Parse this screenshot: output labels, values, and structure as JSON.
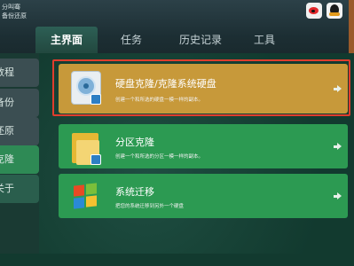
{
  "header": {
    "app_title_line1": "分叫骞",
    "app_title_line2": "备份还原"
  },
  "tabs": [
    {
      "label": "主界面"
    },
    {
      "label": "任务"
    },
    {
      "label": "历史记录"
    },
    {
      "label": "工具"
    }
  ],
  "sidebar": {
    "items": [
      {
        "label": "数程"
      },
      {
        "label": "备份"
      },
      {
        "label": "还原"
      },
      {
        "label": "克隆"
      },
      {
        "label": "关于"
      }
    ]
  },
  "cards": [
    {
      "title": "硬盘克隆/克隆系统硬盘",
      "desc": "创建一个和所选的硬盘一模一样的副本。",
      "icon": "disk-icon"
    },
    {
      "title": "分区克隆",
      "desc": "创建一个和所选的分区一模一样的副本。",
      "icon": "folder-icon"
    },
    {
      "title": "系统迁移",
      "desc": "把您的系统迁移到另外一个硬盘",
      "icon": "windows-icon"
    }
  ],
  "colors": {
    "accent_gold": "#c7993a",
    "accent_green": "#2c9a52",
    "selection_red": "#e03d2d"
  }
}
